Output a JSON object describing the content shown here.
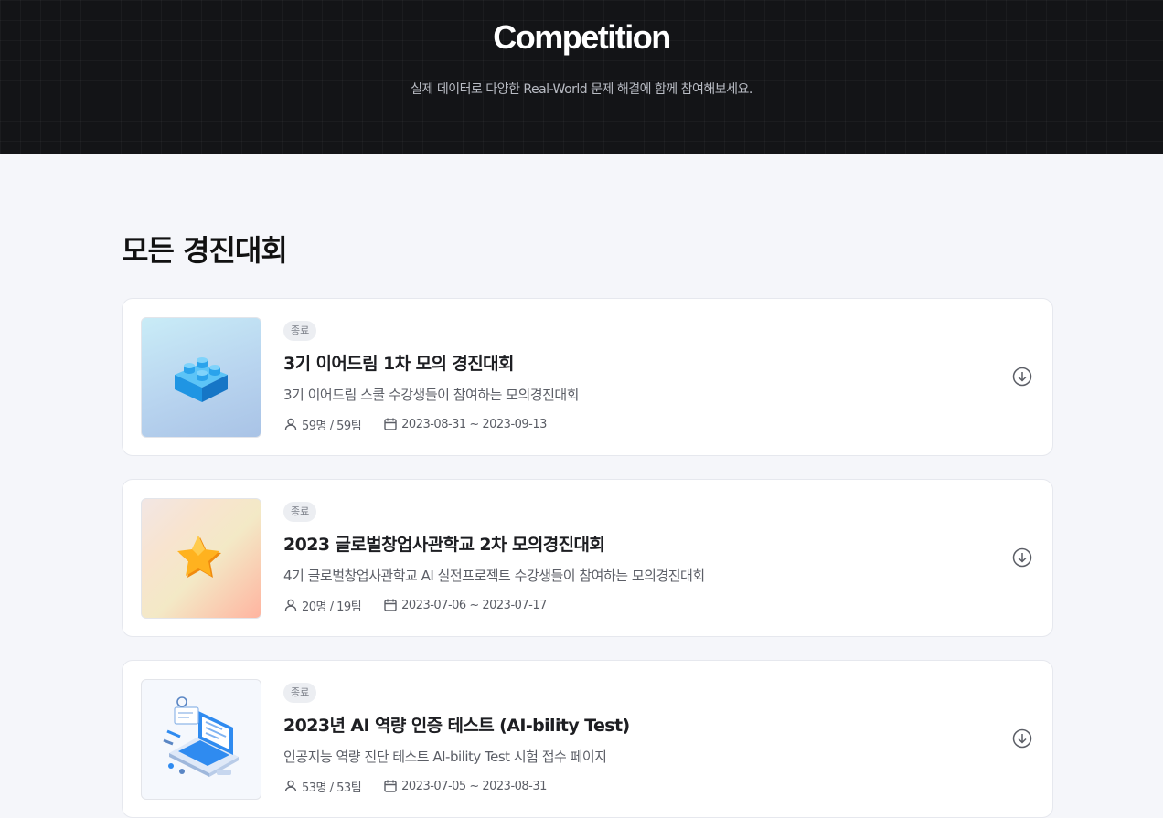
{
  "hero": {
    "title": "Competition",
    "subtitle": "실제 데이터로 다양한 Real-World 문제 해결에 함께 참여해보세요."
  },
  "section": {
    "title": "모든 경진대회"
  },
  "competitions": [
    {
      "status": "종료",
      "title": "3기 이어드림 1차 모의 경진대회",
      "description": "3기 이어드림 스쿨 수강생들이 참여하는 모의경진대회",
      "participants": "59명 / 59팀",
      "period": "2023-08-31 ~ 2023-09-13",
      "thumbnail_icon": "lego-brick-icon"
    },
    {
      "status": "종료",
      "title": "2023 글로벌창업사관학교 2차 모의경진대회",
      "description": "4기 글로벌창업사관학교 AI 실전프로젝트 수강생들이 참여하는 모의경진대회",
      "participants": "20명 / 19팀",
      "period": "2023-07-06 ~ 2023-07-17",
      "thumbnail_icon": "star-icon"
    },
    {
      "status": "종료",
      "title": "2023년 AI 역량 인증 테스트 (AI-bility Test)",
      "description": "인공지능 역량 진단 테스트 AI-bility Test 시험 접수 페이지",
      "participants": "53명 / 53팀",
      "period": "2023-07-05 ~ 2023-08-31",
      "thumbnail_icon": "laptop-illustration-icon"
    }
  ],
  "icons": {
    "participants": "user-icon",
    "period": "calendar-icon",
    "action": "download-circle-icon"
  },
  "colors": {
    "hero_bg": "#131417",
    "page_bg": "#f5f6fa",
    "badge_bg": "#eceef2",
    "accent_blue": "#2f8bf0",
    "star_orange": "#f7a21b"
  }
}
